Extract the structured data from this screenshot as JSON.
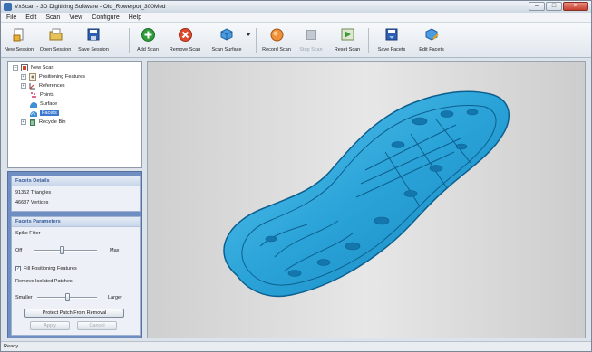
{
  "window": {
    "title": "VxScan - 3D Digitizing Software - Old_Rowerpot_300Med",
    "controls": {
      "minimize": "–",
      "maximize": "□",
      "close": "✕"
    }
  },
  "menu": [
    "File",
    "Edit",
    "Scan",
    "View",
    "Configure",
    "Help"
  ],
  "toolbar": [
    {
      "label": "New Session",
      "icon": "new-session-icon",
      "enabled": true
    },
    {
      "label": "Open Session",
      "icon": "open-session-icon",
      "enabled": true
    },
    {
      "label": "Save Session",
      "icon": "save-session-icon",
      "enabled": true
    },
    {
      "label": "Add Scan",
      "icon": "add-scan-icon",
      "enabled": true
    },
    {
      "label": "Remove Scan",
      "icon": "remove-scan-icon",
      "enabled": true
    },
    {
      "label": "Scan Surface",
      "icon": "scan-surface-icon",
      "enabled": true
    },
    {
      "label": "Record Scan",
      "icon": "record-scan-icon",
      "enabled": true
    },
    {
      "label": "Stop Scan",
      "icon": "stop-scan-icon",
      "enabled": false
    },
    {
      "label": "Reset Scan",
      "icon": "reset-scan-icon",
      "enabled": true
    },
    {
      "label": "Save Facets",
      "icon": "save-facets-icon",
      "enabled": true
    },
    {
      "label": "Edit Facets",
      "icon": "edit-facets-icon",
      "enabled": true
    }
  ],
  "tree": [
    {
      "label": "New Scan",
      "icon": "scan-root-icon",
      "expander": "–",
      "selected": false
    },
    {
      "label": "Positioning Features",
      "icon": "positioning-features-icon",
      "expander": "+",
      "selected": false
    },
    {
      "label": "References",
      "icon": "references-icon",
      "expander": "+",
      "selected": false
    },
    {
      "label": "Points",
      "icon": "points-icon",
      "expander": "",
      "selected": false
    },
    {
      "label": "Surface",
      "icon": "surface-icon",
      "expander": "",
      "selected": false
    },
    {
      "label": "Facets",
      "icon": "facets-icon",
      "expander": "",
      "selected": true
    },
    {
      "label": "Recycle Bin",
      "icon": "recycle-bin-icon",
      "expander": "+",
      "selected": false
    }
  ],
  "details": {
    "header": "Facets Details",
    "triangles": "91352 Triangles",
    "vertices": "46637 Vertices"
  },
  "params": {
    "header": "Facets Parameters",
    "spike_filter_label": "Spike Filter",
    "spike_min": "Off",
    "spike_max": "Max",
    "spike_level": 0.45,
    "fill_label": "Fill Positioning Features",
    "fill_checked": "✓",
    "remove_label": "Remove Isolated Patches",
    "remove_min": "Smaller",
    "remove_max": "Larger",
    "remove_level": 0.5,
    "protect_button": "Protect Patch From Removal",
    "apply_button": "Apply",
    "cancel_button": "Cancel"
  },
  "status": {
    "text": "Ready"
  },
  "colors": {
    "mesh": "#2aa3d8",
    "mesh_dark": "#0d5f8f",
    "selection": "#3b79d3",
    "panel": "#6f8fc2"
  }
}
